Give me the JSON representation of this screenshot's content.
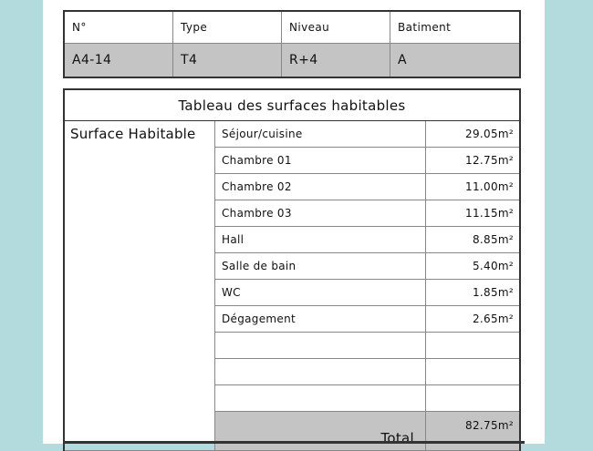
{
  "header": {
    "columns": [
      "N°",
      "Type",
      "Niveau",
      "Batiment"
    ],
    "values": [
      "A4-14",
      "T4",
      "R+4",
      "A"
    ]
  },
  "surfaces": {
    "title": "Tableau des surfaces habitables",
    "label": "Surface Habitable",
    "rows": [
      {
        "room": "Séjour/cuisine",
        "area": "29.05m²"
      },
      {
        "room": "Chambre 01",
        "area": "12.75m²"
      },
      {
        "room": "Chambre 02",
        "area": "11.00m²"
      },
      {
        "room": "Chambre 03",
        "area": "11.15m²"
      },
      {
        "room": "Hall",
        "area": "8.85m²"
      },
      {
        "room": "Salle de bain",
        "area": "5.40m²"
      },
      {
        "room": "WC",
        "area": "1.85m²"
      },
      {
        "room": "Dégagement",
        "area": "2.65m²"
      },
      {
        "room": "",
        "area": ""
      },
      {
        "room": "",
        "area": ""
      },
      {
        "room": "",
        "area": ""
      }
    ],
    "total_label": "Total",
    "total_value": "82.75m²"
  },
  "colors": {
    "background": "#b3dbdd",
    "sheet": "#ffffff",
    "shaded_cell": "#c4c4c4"
  }
}
